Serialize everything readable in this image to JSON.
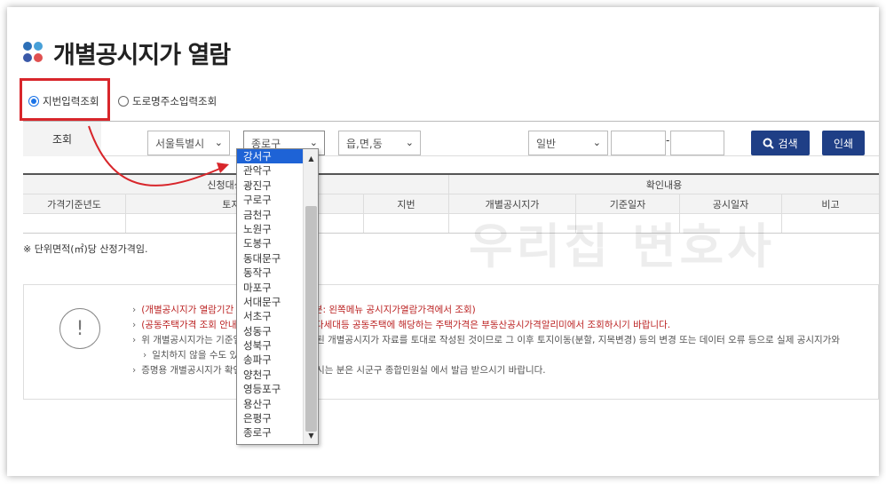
{
  "page": {
    "title": "개별공시지가 열람"
  },
  "radios": [
    {
      "label": "지번입력조회",
      "checked": true
    },
    {
      "label": "도로명주소입력조회",
      "checked": false
    }
  ],
  "search": {
    "label": "조회",
    "city": "서울특별시",
    "district": "종로구",
    "town": "읍,면,동",
    "type": "일반",
    "hyphen": "-",
    "search_button": "검색",
    "print_button": "인쇄"
  },
  "table": {
    "group_headers": [
      "신청대상 토지",
      "확인내용"
    ],
    "columns": [
      "가격기준년도",
      "토지소재지",
      "지번",
      "개별공시지가",
      "기준일자",
      "공시일자",
      "비고"
    ]
  },
  "note": "※ 단위면적(㎡)당 산정가격임.",
  "info": {
    "items": [
      "(개별공시지가 열람기간 외 열람을 원하시는 분: 왼쪽메뉴 공시지가열람가격에서 조회)",
      "(공동주택가격 조회 안내) 아파트, 연립주택, 다세대등 공동주택에 해당하는 주택가격은 부동산공시가격알리미에서 조회하시기 바랍니다.",
      "위 개별공시지가는 기준일자에 해당하는 고시된 개별공시지가 자료를 토대로 작성된 것이므로 그 이후 토지이동(분할, 지목변경) 등의 변경 또는 데이터 오류 등으로 실제 공시지가와",
      "일치하지 않을 수도 있습니다.",
      "증명용 개별공시지가 확인서를 발급받고자 하시는 분은 시군구 종합민원실 에서 발급 받으시기 바랍니다."
    ]
  },
  "watermark": "우리집 변호사",
  "dropdown": {
    "selected": "강서구",
    "options": [
      "강서구",
      "관악구",
      "광진구",
      "구로구",
      "금천구",
      "노원구",
      "도봉구",
      "동대문구",
      "동작구",
      "마포구",
      "서대문구",
      "서초구",
      "성동구",
      "성북구",
      "송파구",
      "양천구",
      "영등포구",
      "용산구",
      "은평구",
      "종로구"
    ]
  },
  "colors": {
    "accent": "#1f3f86",
    "highlight": "#d8262b",
    "selected": "#1e63d6"
  }
}
